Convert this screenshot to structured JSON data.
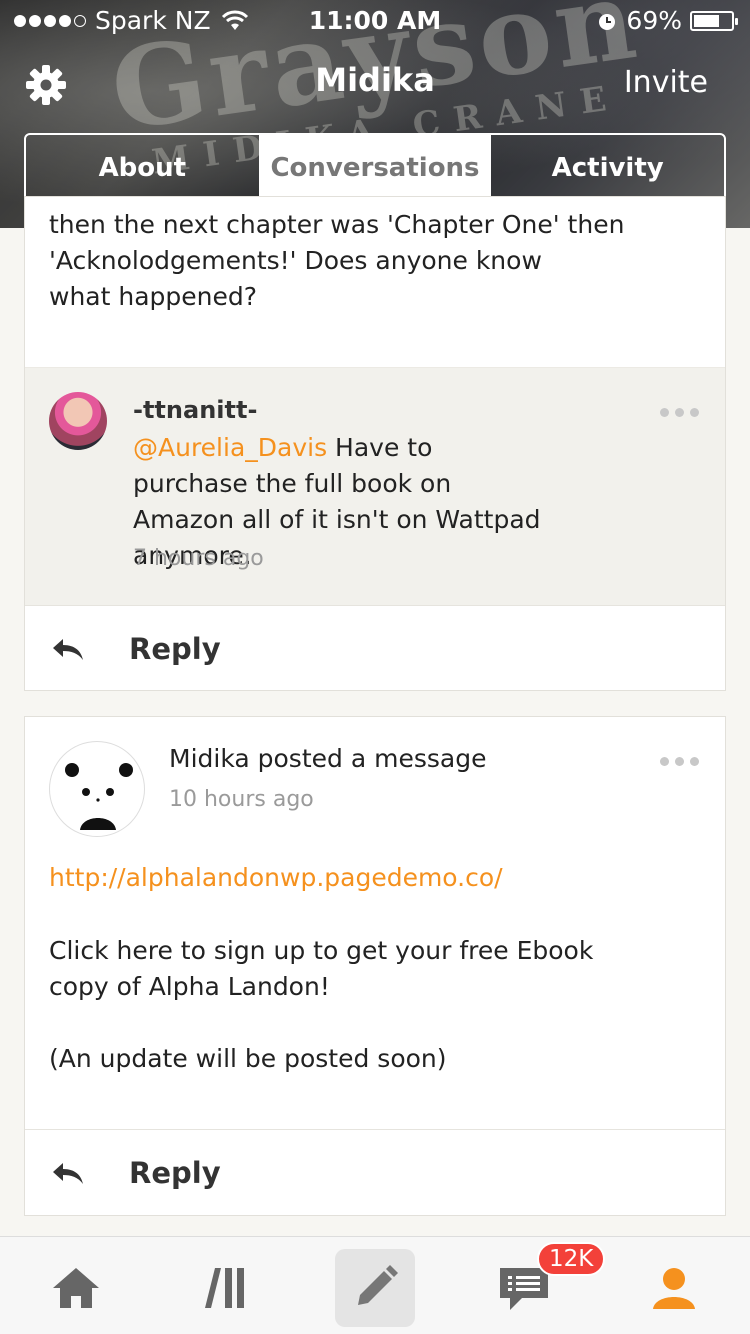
{
  "status_bar": {
    "carrier": "Spark NZ",
    "time": "11:00 AM",
    "battery": "69%",
    "battery_level": 0.69
  },
  "nav": {
    "title": "Midika",
    "invite_label": "Invite",
    "settings_icon": "gear-icon"
  },
  "header_image_text": {
    "large": "Grayson",
    "small": "MIDIKA CRANE"
  },
  "tabs": [
    {
      "label": "About",
      "active": false
    },
    {
      "label": "Conversations",
      "active": true
    },
    {
      "label": "Activity",
      "active": false
    }
  ],
  "post1": {
    "text_clipped": "then the next chapter was 'Chapter One' then",
    "text": "'Acknolodgements!' Does anyone know what happened?",
    "comment": {
      "username": "-ttnanitt-",
      "mention": "@Aurelia_Davis",
      "text": " Have to purchase the full book on Amazon all of it isn't on Wattpad anymore.",
      "time": "7 hours ago"
    },
    "reply_label": "Reply"
  },
  "post2": {
    "author_line": "Midika posted a message",
    "time": "10 hours ago",
    "link": "http://alphalandonwp.pagedemo.co/",
    "paragraph1": "Click here to sign up to get your free Ebook copy of Alpha Landon!",
    "paragraph2": "(An update will be posted soon)",
    "reply_label": "Reply"
  },
  "tabbar": {
    "items": [
      "home-icon",
      "library-icon",
      "write-icon",
      "messages-icon",
      "profile-icon"
    ],
    "messages_badge": "12K",
    "accent_color": "#f5911e"
  }
}
